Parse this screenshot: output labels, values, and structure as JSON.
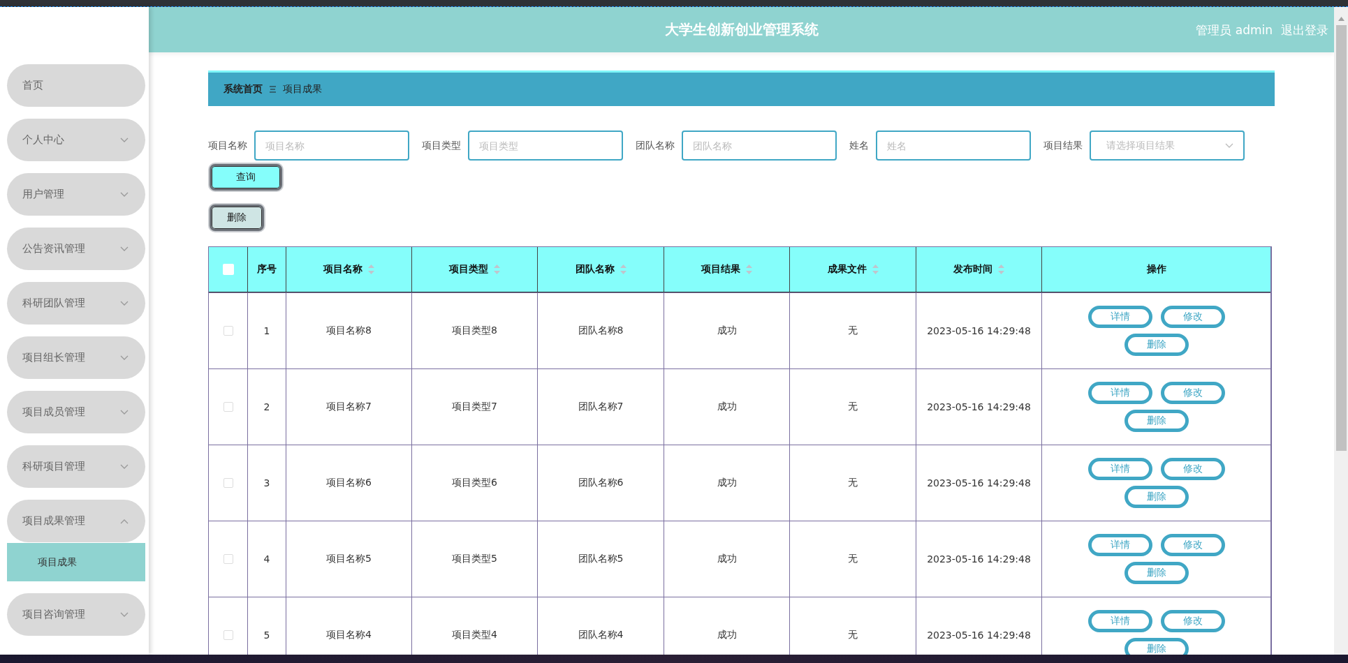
{
  "header": {
    "title": "大学生创新创业管理系统",
    "user": "管理员 admin",
    "logout": "退出登录"
  },
  "menu": [
    {
      "kind": "link",
      "label": "首页"
    },
    {
      "kind": "group",
      "label": "个人中心",
      "expanded": false
    },
    {
      "kind": "group",
      "label": "用户管理",
      "expanded": false
    },
    {
      "kind": "group",
      "label": "公告资讯管理",
      "expanded": false
    },
    {
      "kind": "group",
      "label": "科研团队管理",
      "expanded": false
    },
    {
      "kind": "group",
      "label": "项目组长管理",
      "expanded": false
    },
    {
      "kind": "group",
      "label": "项目成员管理",
      "expanded": false
    },
    {
      "kind": "group",
      "label": "科研项目管理",
      "expanded": false
    },
    {
      "kind": "group",
      "label": "项目成果管理",
      "expanded": true,
      "children": [
        {
          "label": "项目成果",
          "selected": true
        }
      ]
    },
    {
      "kind": "group",
      "label": "项目咨询管理",
      "expanded": false
    }
  ],
  "breadcrumb": {
    "home": "系统首页",
    "current": "项目成果"
  },
  "filters": [
    {
      "kind": "input",
      "label": "项目名称",
      "placeholder": "项目名称"
    },
    {
      "kind": "input",
      "label": "项目类型",
      "placeholder": "项目类型"
    },
    {
      "kind": "input",
      "label": "团队名称",
      "placeholder": "团队名称"
    },
    {
      "kind": "input",
      "label": "姓名",
      "placeholder": "姓名"
    },
    {
      "kind": "select",
      "label": "项目结果",
      "placeholder": "请选择项目结果"
    }
  ],
  "query_button": "查询",
  "delete_button": "删除",
  "table": {
    "all_checked": false,
    "columns": [
      {
        "label": "序号",
        "kind": "plain"
      },
      {
        "label": "项目名称",
        "kind": "sortable"
      },
      {
        "label": "项目类型",
        "kind": "sortable"
      },
      {
        "label": "团队名称",
        "kind": "sortable"
      },
      {
        "label": "项目结果",
        "kind": "sortable"
      },
      {
        "label": "成果文件",
        "kind": "sortable"
      },
      {
        "label": "发布时间",
        "kind": "sortable"
      },
      {
        "label": "操作",
        "kind": "plain"
      }
    ],
    "rows": [
      {
        "checked": false,
        "cells": [
          "1",
          "项目名称8",
          "项目类型8",
          "团队名称8",
          "成功",
          "无",
          "2023-05-16 14:29:48"
        ],
        "actions": [
          "详情",
          "修改",
          "删除"
        ]
      },
      {
        "checked": false,
        "cells": [
          "2",
          "项目名称7",
          "项目类型7",
          "团队名称7",
          "成功",
          "无",
          "2023-05-16 14:29:48"
        ],
        "actions": [
          "详情",
          "修改",
          "删除"
        ]
      },
      {
        "checked": false,
        "cells": [
          "3",
          "项目名称6",
          "项目类型6",
          "团队名称6",
          "成功",
          "无",
          "2023-05-16 14:29:48"
        ],
        "actions": [
          "详情",
          "修改",
          "删除"
        ]
      },
      {
        "checked": false,
        "cells": [
          "4",
          "项目名称5",
          "项目类型5",
          "团队名称5",
          "成功",
          "无",
          "2023-05-16 14:29:48"
        ],
        "actions": [
          "详情",
          "修改",
          "删除"
        ]
      },
      {
        "checked": false,
        "cells": [
          "5",
          "项目名称4",
          "项目类型4",
          "团队名称4",
          "成功",
          "无",
          "2023-05-16 14:29:48"
        ],
        "actions": [
          "详情",
          "修改",
          "删除"
        ]
      }
    ]
  }
}
